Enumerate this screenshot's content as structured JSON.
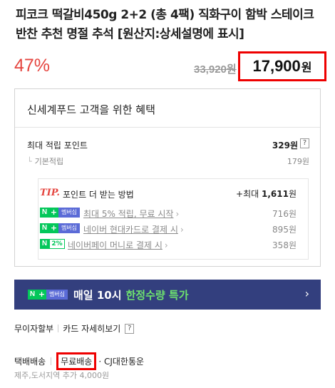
{
  "product": {
    "title": "피코크 떡갈비450g 2+2 (총 4팩) 직화구이 함박 스테이크 반찬 추천 명절 추석 [원산지:상세설명에 표시]",
    "discount": "47%",
    "original_price": "33,920원",
    "sale_price": "17,900",
    "price_unit": "원"
  },
  "benefit": {
    "title": "신세계푸드 고객을 위한 혜택",
    "max_points_label": "최대 적립 포인트",
    "max_points_value": "329원",
    "help": "?",
    "base_label": "기본적립",
    "base_branch": "└",
    "base_value": "179원",
    "tip": {
      "label": "TIP.",
      "text": "포인트 더 받는 방법",
      "max_prefix": "+최대",
      "max_value": "1,611",
      "max_unit": "원",
      "items": [
        {
          "badge": "membership",
          "link": "최대 5% 적립, 무료 시작",
          "amount": "716원"
        },
        {
          "badge": "membership",
          "link": "네이버 현대카드로 결제 시",
          "amount": "895원"
        },
        {
          "badge": "pay",
          "link": "네이버페이 머니로 결제 시",
          "amount": "358원"
        }
      ]
    },
    "badge_text": {
      "n": "N",
      "plus": "+",
      "membership": "멤버십",
      "pct": "2%"
    }
  },
  "banner": {
    "text1": "매일 10시",
    "text2": "한정수량 특가",
    "chevron": "›"
  },
  "payment": {
    "installment": "무이자할부",
    "card_details": "카드 자세히보기",
    "help": "?"
  },
  "shipping": {
    "type": "택배배송",
    "fee": "무료배송",
    "carrier": "· CJ대한통운",
    "note": "제주,도서지역 추가 4,000원"
  },
  "colors": {
    "discount": "#e5453f",
    "highlight_border": "#e00000",
    "naver_green": "#03c75a",
    "banner_bg": "#333f7e",
    "banner_accent": "#6ee26e"
  }
}
